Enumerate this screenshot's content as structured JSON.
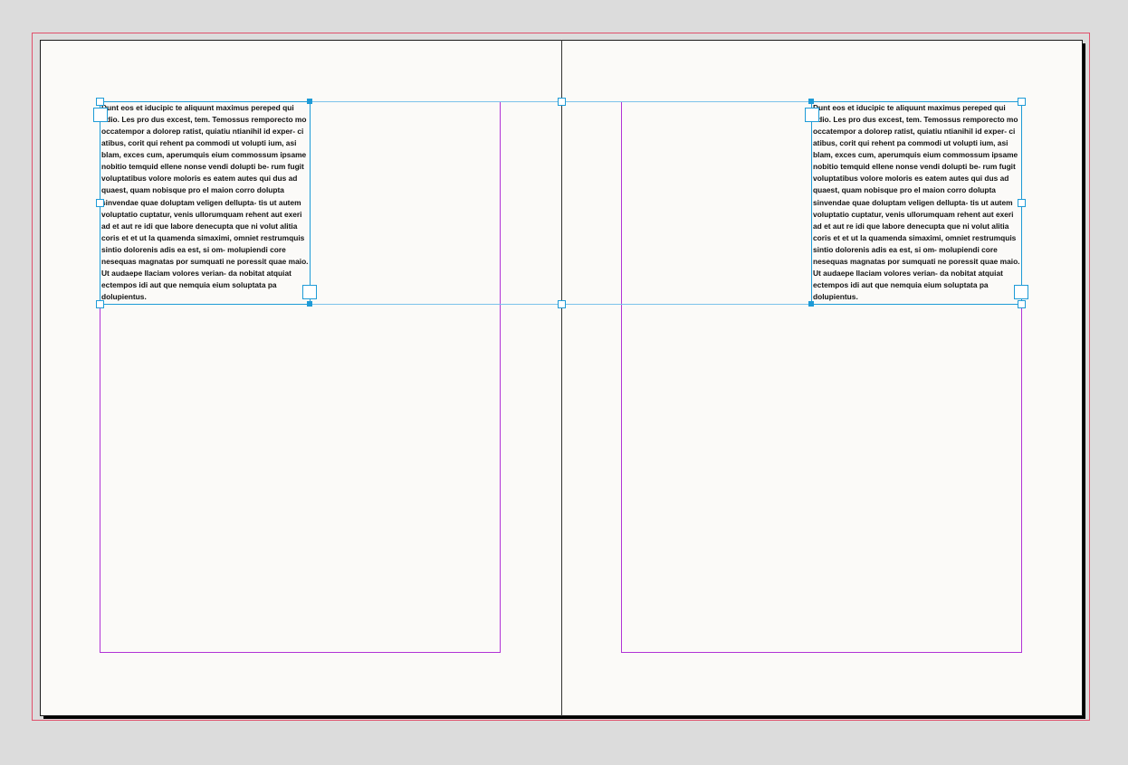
{
  "document": {
    "body_text": "Dunt eos et iducipic te aliquunt maximus pereped qui odio. Les pro dus excest, tem. Temossus remporecto mo occatempor a dolorep ratist, quiatiu ntianihil id exper- ci atibus, corit qui rehent pa commodi ut volupti ium, asi blam, exces cum, aperumquis eium commossum ipsame nobitio temquid ellene nonse vendi dolupti be- rum fugit voluptatibus volore moloris es eatem autes qui dus ad quaest, quam nobisque pro el maion corro dolupta sinvendae quae doluptam veligen dellupta- tis ut autem voluptatio cuptatur, venis ullorumquam rehent aut exeri ad et aut re idi que labore denecupta que ni volut alitia coris et et ut la quamenda simaximi, omniet restrumquis sintio dolorenis adis ea est, si om- molupiendi core nesequas magnatas por sumquati ne poressit quae maio. Ut audaepe llaciam volores verian- da nobitat atquiat ectempos idi aut que nemquia eium soluptata pa dolupientus."
  },
  "colors": {
    "pasteboard": "#dcdcdc",
    "page": "#fbfaf8",
    "bleed_guide": "#e0506b",
    "margin_guide": "#b133d6",
    "selection": "#1e9bd7"
  }
}
